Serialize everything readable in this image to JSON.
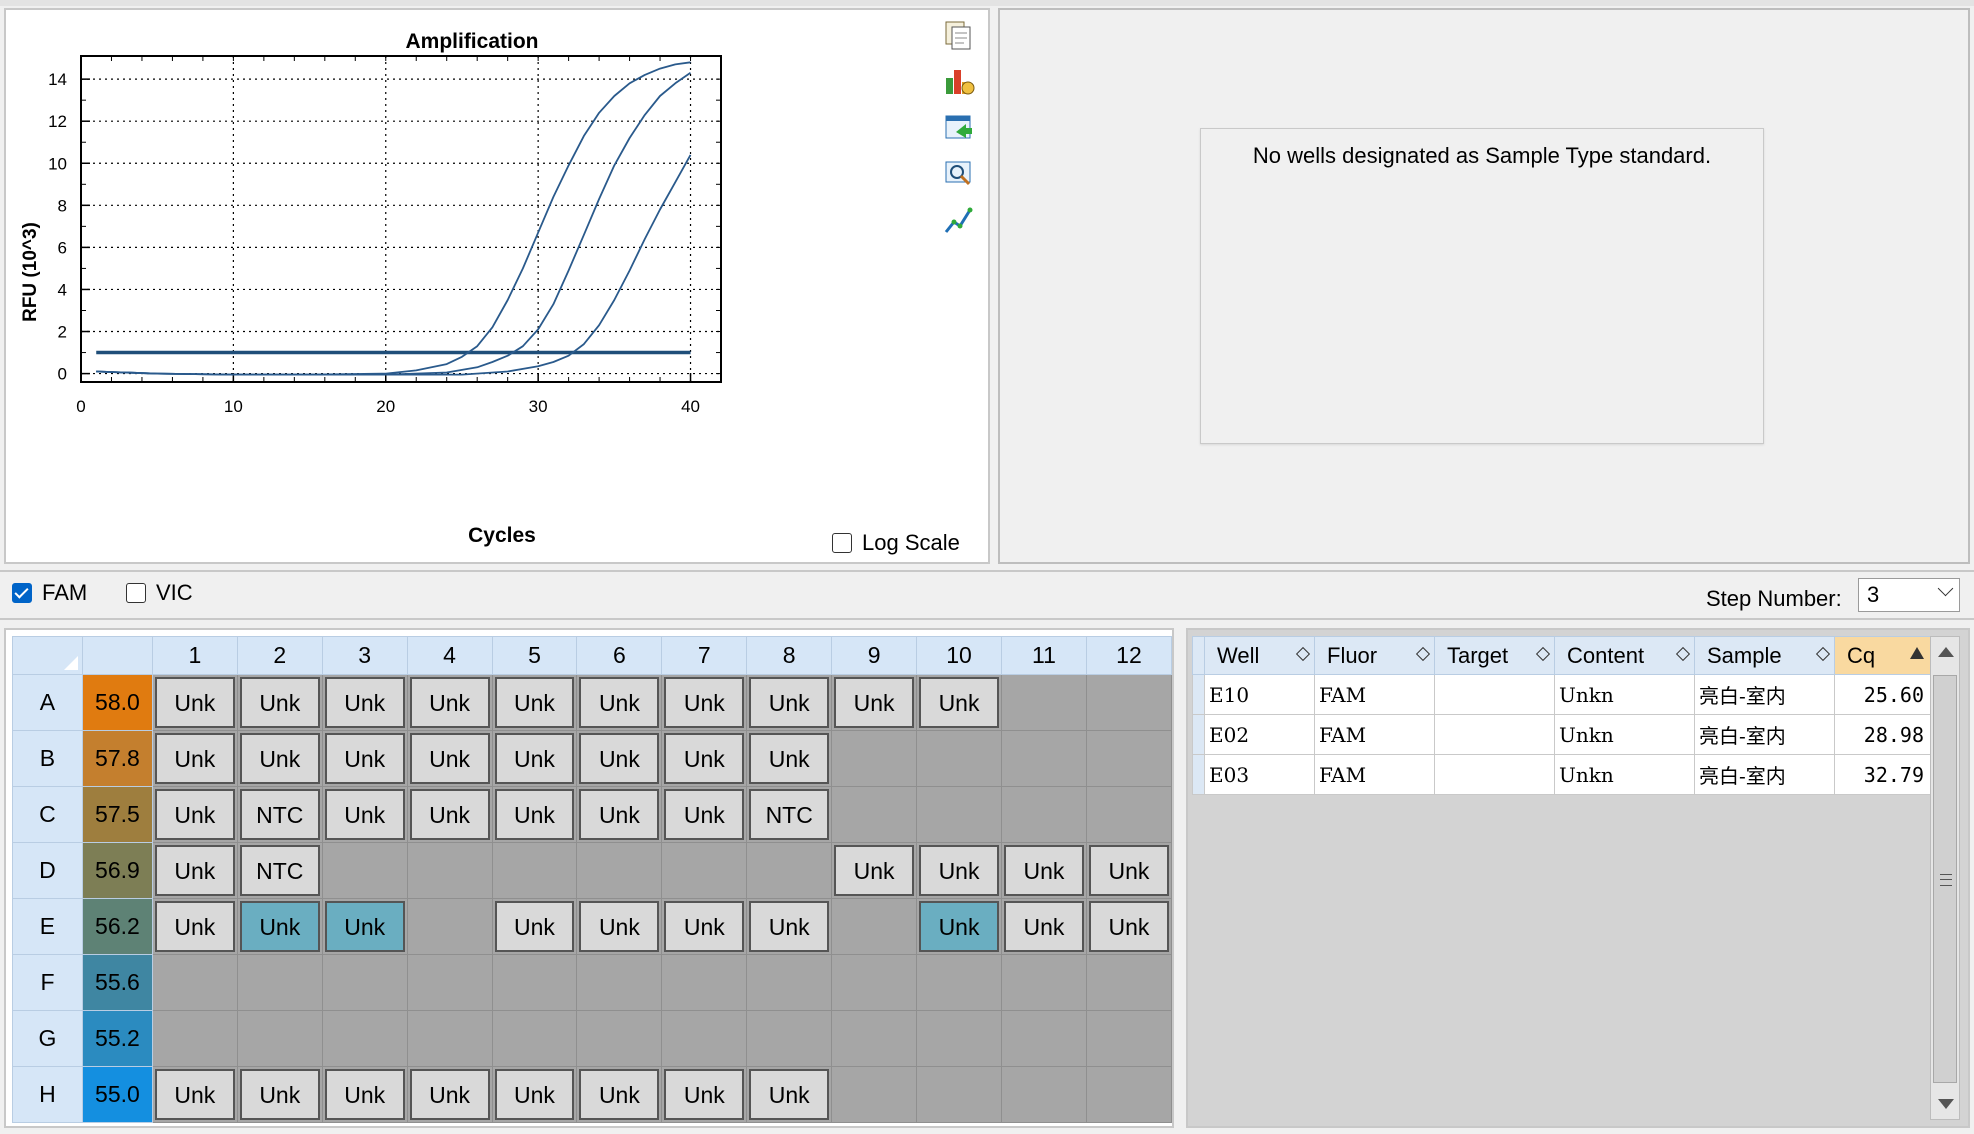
{
  "chart_data": {
    "type": "line",
    "title": "Amplification",
    "xlabel": "Cycles",
    "ylabel": "RFU (10^3)",
    "xlim": [
      0,
      42
    ],
    "ylim": [
      -0.4,
      15.1
    ],
    "x_ticks": [
      0,
      10,
      20,
      30,
      40
    ],
    "y_ticks": [
      0,
      2,
      4,
      6,
      8,
      10,
      12,
      14
    ],
    "grid": true,
    "log_scale": false,
    "threshold": 1.0,
    "series": [
      {
        "well": "E10",
        "cq": 25.6,
        "x": [
          1,
          5,
          10,
          15,
          20,
          22,
          24,
          25,
          26,
          27,
          28,
          29,
          30,
          31,
          32,
          33,
          34,
          35,
          36,
          37,
          38,
          39,
          40
        ],
        "values": [
          0.1,
          0.0,
          -0.05,
          -0.05,
          0.0,
          0.15,
          0.45,
          0.8,
          1.3,
          2.2,
          3.5,
          5.0,
          6.7,
          8.4,
          9.9,
          11.3,
          12.4,
          13.2,
          13.8,
          14.2,
          14.5,
          14.7,
          14.8
        ]
      },
      {
        "well": "E02",
        "cq": 28.98,
        "x": [
          1,
          5,
          10,
          15,
          20,
          24,
          26,
          27,
          28,
          29,
          30,
          31,
          32,
          33,
          34,
          35,
          36,
          37,
          38,
          39,
          40
        ],
        "values": [
          0.1,
          0.0,
          -0.05,
          -0.05,
          -0.05,
          0.05,
          0.3,
          0.55,
          0.85,
          1.3,
          2.1,
          3.3,
          4.9,
          6.6,
          8.3,
          9.9,
          11.2,
          12.3,
          13.2,
          13.8,
          14.3
        ]
      },
      {
        "well": "E03",
        "cq": 32.79,
        "x": [
          1,
          5,
          10,
          15,
          20,
          25,
          28,
          30,
          31,
          32,
          33,
          34,
          35,
          36,
          37,
          38,
          39,
          40
        ],
        "values": [
          0.1,
          0.0,
          -0.05,
          -0.05,
          -0.05,
          -0.05,
          0.1,
          0.35,
          0.55,
          0.85,
          1.4,
          2.3,
          3.5,
          4.9,
          6.4,
          7.8,
          9.1,
          10.4
        ]
      }
    ]
  },
  "chart": {
    "title": "Amplification",
    "xlabel": "Cycles",
    "ylabel": "RFU (10^3)",
    "log_scale_label": "Log Scale",
    "line_color": "#2a5a8c",
    "threshold_color": "#1f4e79",
    "tools": [
      "copy-icon",
      "chart-settings-icon",
      "export-icon",
      "zoom-icon",
      "line-style-icon"
    ]
  },
  "standard": {
    "message": "No wells designated as Sample Type standard."
  },
  "fluor_bar": {
    "fam_label": "FAM",
    "fam_checked": true,
    "vic_label": "VIC",
    "vic_checked": false,
    "step_label": "Step Number:",
    "step_value": "3"
  },
  "plate": {
    "columns": [
      "1",
      "2",
      "3",
      "4",
      "5",
      "6",
      "7",
      "8",
      "9",
      "10",
      "11",
      "12"
    ],
    "rows": [
      {
        "label": "A",
        "temp": "58.0",
        "temp_color": "#e07b10",
        "wells": [
          "Unk",
          "Unk",
          "Unk",
          "Unk",
          "Unk",
          "Unk",
          "Unk",
          "Unk",
          "Unk",
          "Unk",
          "",
          ""
        ]
      },
      {
        "label": "B",
        "temp": "57.8",
        "temp_color": "#c47f2e",
        "wells": [
          "Unk",
          "Unk",
          "Unk",
          "Unk",
          "Unk",
          "Unk",
          "Unk",
          "Unk",
          "",
          "",
          "",
          ""
        ]
      },
      {
        "label": "C",
        "temp": "57.5",
        "temp_color": "#9e7e3e",
        "wells": [
          "Unk",
          "NTC",
          "Unk",
          "Unk",
          "Unk",
          "Unk",
          "Unk",
          "NTC",
          "",
          "",
          "",
          ""
        ]
      },
      {
        "label": "D",
        "temp": "56.9",
        "temp_color": "#7d7e55",
        "wells": [
          "Unk",
          "NTC",
          "",
          "",
          "",
          "",
          "",
          "",
          "Unk",
          "Unk",
          "Unk",
          "Unk"
        ]
      },
      {
        "label": "E",
        "temp": "56.2",
        "temp_color": "#5e8275",
        "wells": [
          "Unk",
          "Unk",
          "Unk",
          "",
          "Unk",
          "Unk",
          "Unk",
          "Unk",
          "",
          "Unk",
          "Unk",
          "Unk"
        ]
      },
      {
        "label": "F",
        "temp": "55.6",
        "temp_color": "#3f86a2",
        "wells": [
          "",
          "",
          "",
          "",
          "",
          "",
          "",
          "",
          "",
          "",
          "",
          ""
        ]
      },
      {
        "label": "G",
        "temp": "55.2",
        "temp_color": "#2b8bc0",
        "wells": [
          "",
          "",
          "",
          "",
          "",
          "",
          "",
          "",
          "",
          "",
          "",
          ""
        ]
      },
      {
        "label": "H",
        "temp": "55.0",
        "temp_color": "#148fe0",
        "wells": [
          "Unk",
          "Unk",
          "Unk",
          "Unk",
          "Unk",
          "Unk",
          "Unk",
          "Unk",
          "",
          "",
          "",
          ""
        ]
      }
    ],
    "selected_wells": [
      "E2",
      "E3",
      "E10"
    ]
  },
  "results": {
    "headers": [
      "Well",
      "Fluor",
      "Target",
      "Content",
      "Sample",
      "Cq"
    ],
    "rows": [
      [
        "E10",
        "FAM",
        "",
        "Unkn",
        "亮白-室内",
        "25.60"
      ],
      [
        "E02",
        "FAM",
        "",
        "Unkn",
        "亮白-室内",
        "28.98"
      ],
      [
        "E03",
        "FAM",
        "",
        "Unkn",
        "亮白-室内",
        "32.79"
      ]
    ]
  }
}
